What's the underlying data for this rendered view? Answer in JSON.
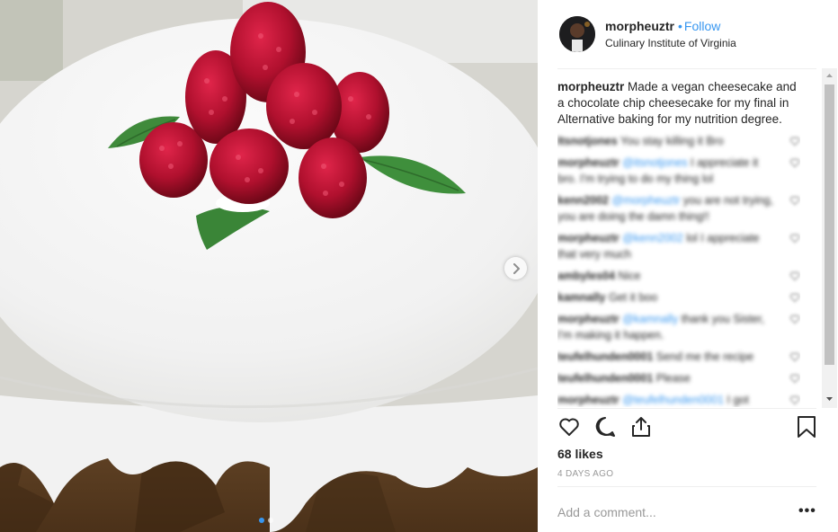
{
  "post": {
    "username": "morpheuztr",
    "separator": "•",
    "follow_label": "Follow",
    "location": "Culinary Institute of Virginia",
    "caption_user": "morpheuztr",
    "caption_text": " Made a vegan cheesecake and a chocolate chip cheesecake for my final in Alternative baking for my nutrition degree."
  },
  "comments": [
    {
      "user": "Itsnotjones",
      "mention": "",
      "text": " You stay killing it Bro"
    },
    {
      "user": "morpheuztr",
      "mention": "@itsnotjones",
      "text": " I appreciate it bro. I'm trying to do my thing lol"
    },
    {
      "user": "kenn2002",
      "mention": "@morpheuztr",
      "text": " you are not trying, you are doing the damn thing!!"
    },
    {
      "user": "morpheuztr",
      "mention": "@kenn2002",
      "text": " lol I appreciate that very much"
    },
    {
      "user": "ambyles04",
      "mention": "",
      "text": " Nice"
    },
    {
      "user": "kamnally",
      "mention": "",
      "text": " Get it boo"
    },
    {
      "user": "morpheuztr",
      "mention": "@kamnally",
      "text": " thank you Sister, I'm making it happen."
    },
    {
      "user": "teufelhunden0001",
      "mention": "",
      "text": " Send me the recipe"
    },
    {
      "user": "teufelhunden0001",
      "mention": "",
      "text": " Please"
    },
    {
      "user": "morpheuztr",
      "mention": "@teufelhunden0001",
      "text": " I got"
    }
  ],
  "likes": "68 likes",
  "date": "4 DAYS AGO",
  "add_comment_placeholder": "Add a comment...",
  "more_label": "•••",
  "icons": {
    "like": "heart-icon",
    "comment": "comment-icon",
    "share": "share-icon",
    "save": "bookmark-icon",
    "next": "chevron-right-icon"
  },
  "carousel": {
    "count": 2,
    "active": 0
  },
  "colors": {
    "link": "#3897f0",
    "text": "#262626",
    "muted": "#999999",
    "divider": "#efefef"
  }
}
